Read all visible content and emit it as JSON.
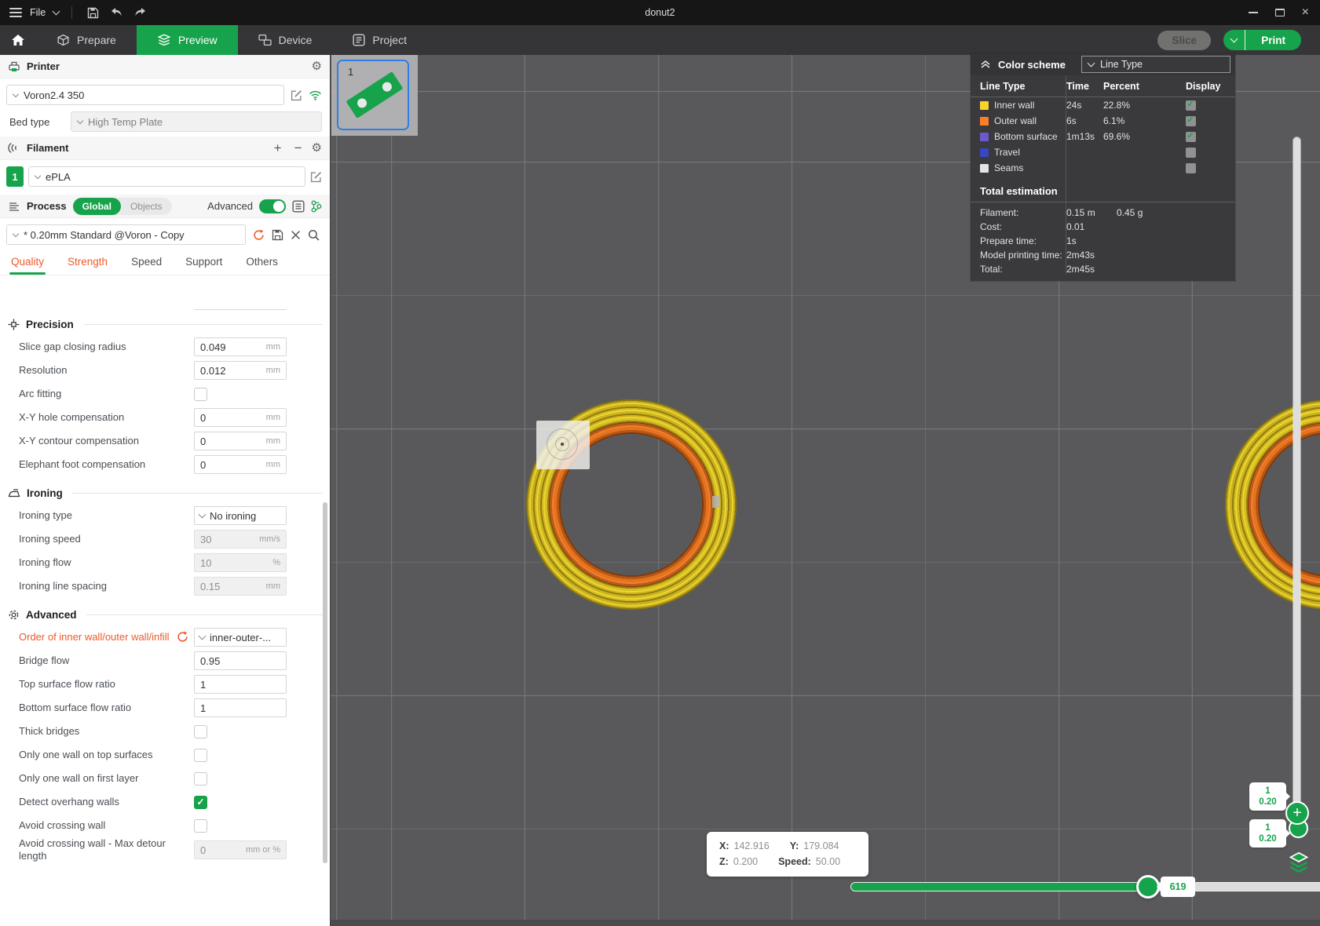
{
  "window": {
    "title": "donut2"
  },
  "menubar": {
    "file_label": "File"
  },
  "nav": {
    "tabs": [
      {
        "label": "Prepare",
        "active": false
      },
      {
        "label": "Preview",
        "active": true
      },
      {
        "label": "Device",
        "active": false
      },
      {
        "label": "Project",
        "active": false
      }
    ],
    "slice_label": "Slice",
    "print_label": "Print"
  },
  "printer": {
    "header": "Printer",
    "name": "Voron2.4 350",
    "bed_type_label": "Bed type",
    "bed_type": "High Temp Plate"
  },
  "filament": {
    "header": "Filament",
    "slot": "1",
    "name": "ePLA"
  },
  "process": {
    "header": "Process",
    "scope": {
      "global_label": "Global",
      "objects_label": "Objects",
      "selected": "Global"
    },
    "advanced_label": "Advanced",
    "advanced_on": true,
    "preset": "* 0.20mm Standard @Voron - Copy",
    "tabs": [
      {
        "label": "Quality",
        "active": true,
        "warn": true
      },
      {
        "label": "Strength",
        "active": false,
        "warn": true
      },
      {
        "label": "Speed",
        "active": false,
        "warn": false
      },
      {
        "label": "Support",
        "active": false,
        "warn": false
      },
      {
        "label": "Others",
        "active": false,
        "warn": false
      }
    ]
  },
  "settings": {
    "groups": [
      {
        "title": "Precision",
        "icon": "precision-icon",
        "rows": [
          {
            "label": "Slice gap closing radius",
            "type": "input",
            "value": "0.049",
            "unit": "mm"
          },
          {
            "label": "Resolution",
            "type": "input",
            "value": "0.012",
            "unit": "mm"
          },
          {
            "label": "Arc fitting",
            "type": "checkbox",
            "checked": false
          },
          {
            "label": "X-Y hole compensation",
            "type": "input",
            "value": "0",
            "unit": "mm"
          },
          {
            "label": "X-Y contour compensation",
            "type": "input",
            "value": "0",
            "unit": "mm"
          },
          {
            "label": "Elephant foot compensation",
            "type": "input",
            "value": "0",
            "unit": "mm"
          }
        ]
      },
      {
        "title": "Ironing",
        "icon": "ironing-icon",
        "rows": [
          {
            "label": "Ironing type",
            "type": "select",
            "value": "No ironing"
          },
          {
            "label": "Ironing speed",
            "type": "input",
            "value": "30",
            "unit": "mm/s",
            "disabled": true
          },
          {
            "label": "Ironing flow",
            "type": "input",
            "value": "10",
            "unit": "%",
            "disabled": true
          },
          {
            "label": "Ironing line spacing",
            "type": "input",
            "value": "0.15",
            "unit": "mm",
            "disabled": true
          }
        ]
      },
      {
        "title": "Advanced",
        "icon": "advanced-icon",
        "rows": [
          {
            "label": "Order of inner wall/outer wall/infill",
            "type": "select",
            "value": "inner-outer-...",
            "modified": true
          },
          {
            "label": "Bridge flow",
            "type": "input",
            "value": "0.95",
            "unit": ""
          },
          {
            "label": "Top surface flow ratio",
            "type": "input",
            "value": "1",
            "unit": ""
          },
          {
            "label": "Bottom surface flow ratio",
            "type": "input",
            "value": "1",
            "unit": ""
          },
          {
            "label": "Thick bridges",
            "type": "checkbox",
            "checked": false
          },
          {
            "label": "Only one wall on top surfaces",
            "type": "checkbox",
            "checked": false
          },
          {
            "label": "Only one wall on first layer",
            "type": "checkbox",
            "checked": false
          },
          {
            "label": "Detect overhang walls",
            "type": "checkbox",
            "checked": true
          },
          {
            "label": "Avoid crossing wall",
            "type": "checkbox",
            "checked": false
          },
          {
            "label": "Avoid crossing wall - Max detour length",
            "type": "input",
            "value": "0",
            "unit": "mm or %",
            "disabled": true
          }
        ]
      }
    ]
  },
  "legend": {
    "title": "Color scheme",
    "view_mode": "Line Type",
    "columns": [
      "Line Type",
      "Time",
      "Percent",
      "Display"
    ],
    "rows": [
      {
        "name": "Inner wall",
        "color": "#F9D32C",
        "time": "24s",
        "percent": "22.8%",
        "visible": true
      },
      {
        "name": "Outer wall",
        "color": "#FF7E26",
        "time": "6s",
        "percent": "6.1%",
        "visible": true
      },
      {
        "name": "Bottom surface",
        "color": "#6A5ACD",
        "time": "1m13s",
        "percent": "69.6%",
        "visible": true
      },
      {
        "name": "Travel",
        "color": "#3944C7",
        "time": "",
        "percent": "",
        "visible": false
      },
      {
        "name": "Seams",
        "color": "#E3E3E3",
        "time": "",
        "percent": "",
        "visible": false
      }
    ],
    "totals_title": "Total estimation",
    "totals": [
      {
        "label": "Filament:",
        "value": "0.15 m",
        "value2": "0.45 g"
      },
      {
        "label": "Cost:",
        "value": "0.01",
        "value2": ""
      },
      {
        "label": "Prepare time:",
        "value": "1s",
        "value2": ""
      },
      {
        "label": "Model printing time:",
        "value": "2m43s",
        "value2": ""
      },
      {
        "label": "Total:",
        "value": "2m45s",
        "value2": ""
      }
    ]
  },
  "viewport": {
    "plate_number": "1",
    "tooltip": {
      "x_label": "X:",
      "x": "142.916",
      "y_label": "Y:",
      "y": "179.084",
      "z_label": "Z:",
      "z": "0.200",
      "speed_label": "Speed:",
      "speed": "50.00"
    },
    "hslider_value": "619",
    "layer_badges": [
      {
        "line1": "1",
        "line2": "0.20"
      },
      {
        "line1": "1",
        "line2": "0.20"
      }
    ]
  },
  "colors": {
    "accent": "#17A34B",
    "modified": "#ED5A29",
    "viewport_bg": "#59595B"
  }
}
